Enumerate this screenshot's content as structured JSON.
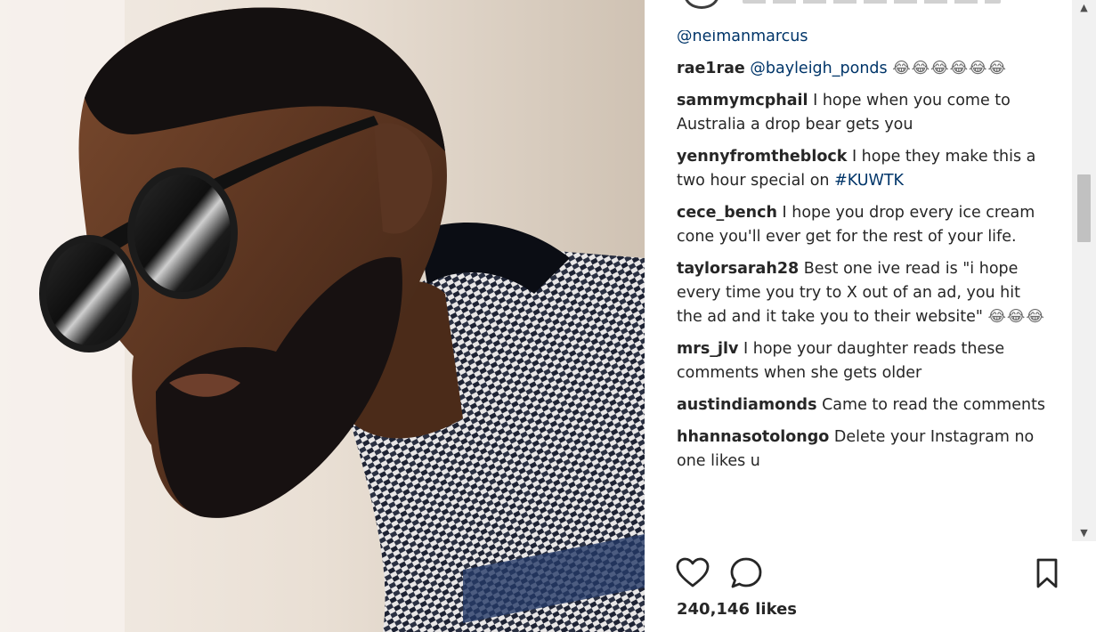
{
  "post": {
    "comments": [
      {
        "user": "",
        "parts": [
          {
            "type": "mention",
            "text": "@neimanmarcus"
          }
        ]
      },
      {
        "user": "rae1rae",
        "parts": [
          {
            "type": "mention",
            "text": "@bayleigh_ponds"
          },
          {
            "type": "emoji",
            "text": "😂😂😂😂😂😂"
          }
        ]
      },
      {
        "user": "sammymcphail",
        "parts": [
          {
            "type": "text",
            "text": "I hope when you come to Australia a drop bear gets you"
          }
        ]
      },
      {
        "user": "yennyfromtheblock",
        "parts": [
          {
            "type": "text",
            "text": "I hope they make this a two hour special on "
          },
          {
            "type": "tag",
            "text": "#KUWTK"
          }
        ]
      },
      {
        "user": "cece_bench",
        "parts": [
          {
            "type": "text",
            "text": "I hope you drop every ice cream cone you'll ever get for the rest of your life."
          }
        ]
      },
      {
        "user": "taylorsarah28",
        "parts": [
          {
            "type": "text",
            "text": "Best one ive read is \"i hope every time you try to X out of an ad, you hit the ad and it take you to their website\" "
          },
          {
            "type": "emoji",
            "text": "😂😂😂"
          }
        ]
      },
      {
        "user": "mrs_jlv",
        "parts": [
          {
            "type": "text",
            "text": "I hope your daughter reads these comments when she gets older"
          }
        ]
      },
      {
        "user": "austindiamonds",
        "parts": [
          {
            "type": "text",
            "text": "Came to read the comments"
          }
        ]
      },
      {
        "user": "hhannasotolongo",
        "parts": [
          {
            "type": "text",
            "text": "Delete your Instagram no one likes u"
          }
        ]
      }
    ],
    "likes_count": "240,146",
    "likes_label": "likes"
  },
  "icons": {
    "like": "heart-outline-icon",
    "comment": "speech-bubble-icon",
    "save": "bookmark-outline-icon"
  },
  "colors": {
    "mention": "#003569",
    "text": "#262626",
    "scroll_thumb": "#c1c1c1"
  }
}
